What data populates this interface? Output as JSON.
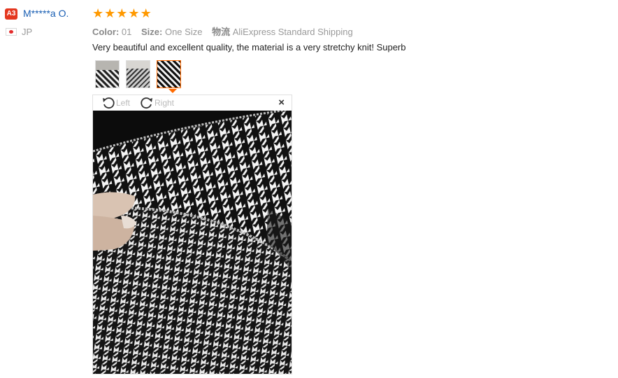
{
  "reviewer": {
    "badge": "A3",
    "name": "M*****a O.",
    "country": "JP"
  },
  "rating": {
    "stars": 5,
    "max": 5
  },
  "meta": {
    "color_label": "Color:",
    "color_value": "01",
    "size_label": "Size:",
    "size_value": "One Size",
    "shipping_label": "物流",
    "shipping_value": "AliExpress Standard Shipping"
  },
  "review": {
    "text": "Very beautiful and excellent quality, the material is a very stretchy knit! Superb"
  },
  "viewer": {
    "rotate_left": "Left",
    "rotate_right": "Right",
    "close": "×"
  },
  "colors": {
    "accent": "#ff6a00",
    "star": "#ff9900",
    "name": "#1a5fb4",
    "badge": "#e4371f"
  }
}
